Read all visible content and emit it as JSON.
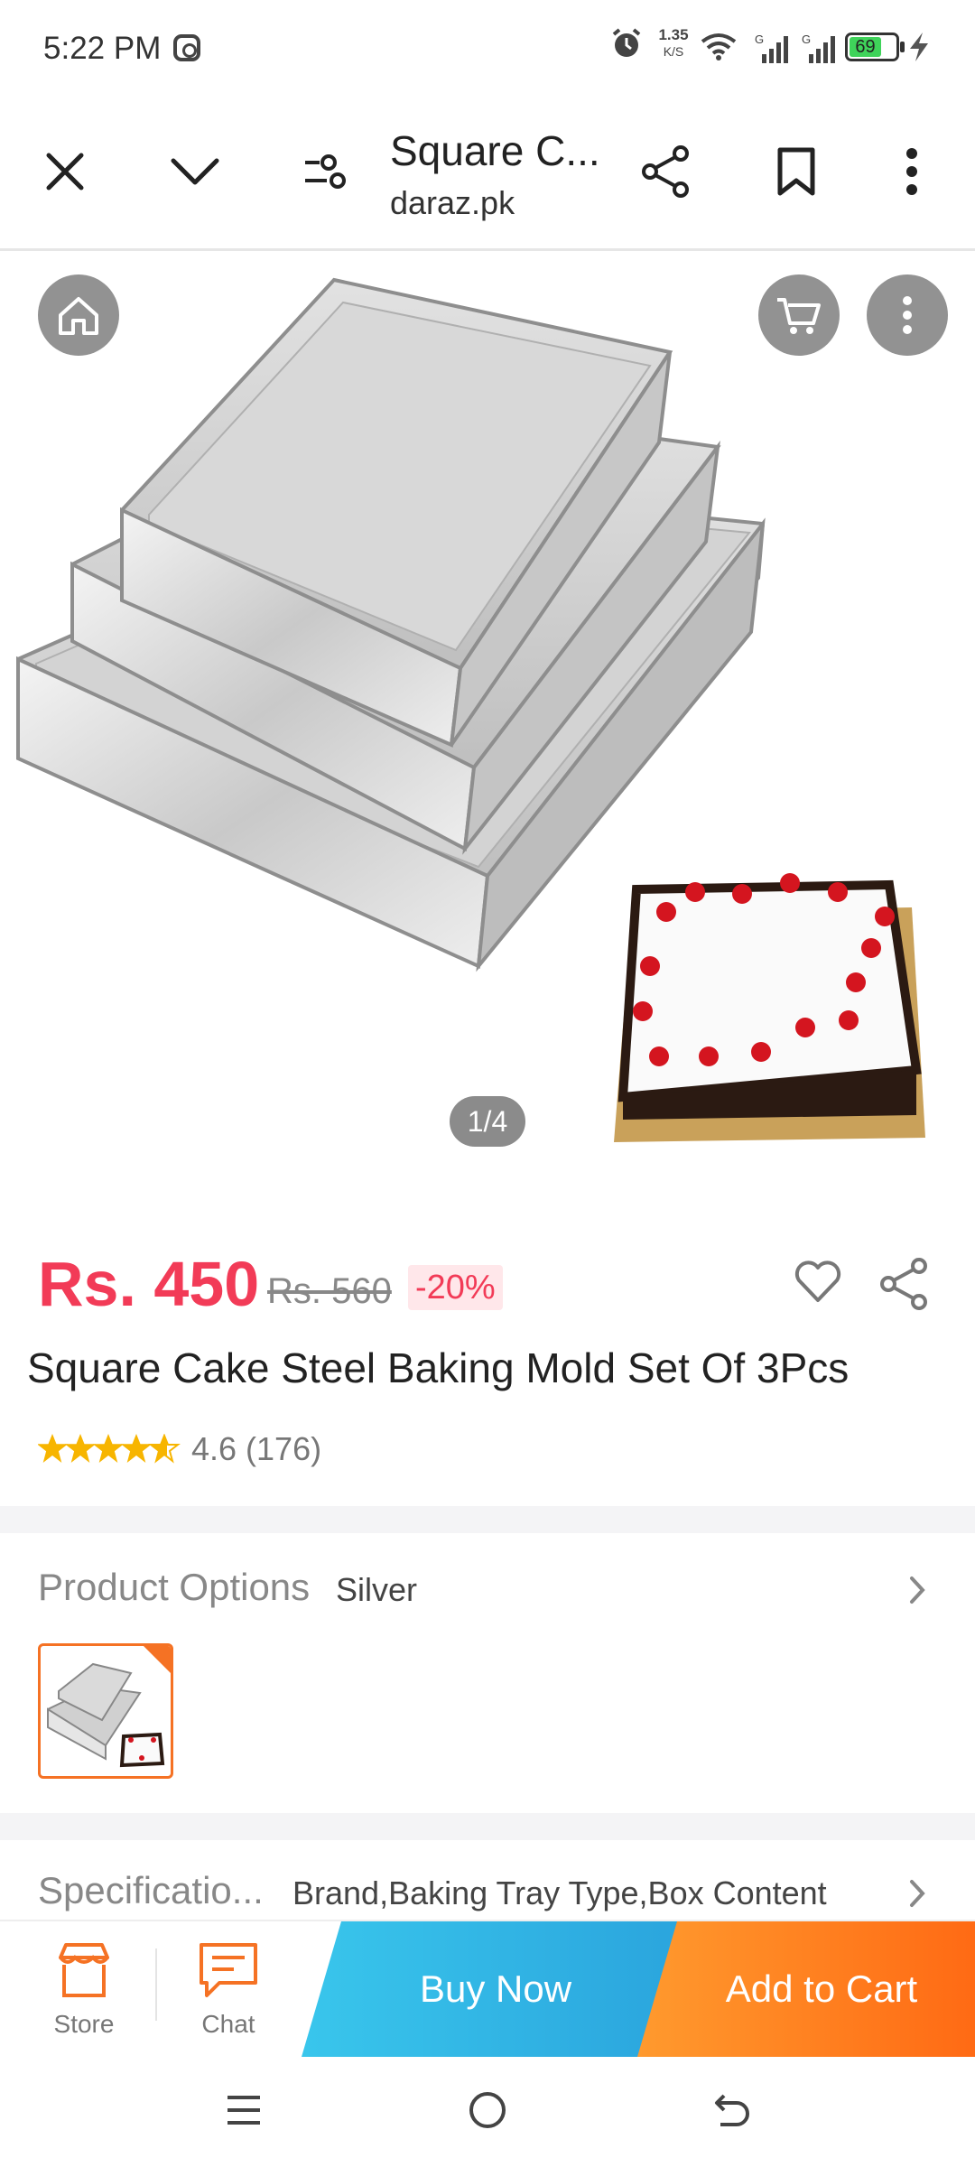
{
  "status_bar": {
    "time": "5:22 PM",
    "net_speed_top": "1.35",
    "net_speed_bottom": "K/S",
    "battery": "69",
    "icons": [
      "instagram-icon",
      "alarm-icon",
      "wifi-icon",
      "signal-icon",
      "battery-icon",
      "charging-icon"
    ]
  },
  "browser": {
    "title": "Square C...",
    "url": "daraz.pk"
  },
  "gallery": {
    "counter": "1/4"
  },
  "product": {
    "price": "Rs. 450",
    "original_price": "Rs. 560",
    "discount": "-20%",
    "title": "Square Cake Steel Baking Mold Set Of 3Pcs",
    "rating": 4.6,
    "rating_text": "4.6 (176)",
    "star_color": "#f7b500"
  },
  "options": {
    "label": "Product Options",
    "value": "Silver"
  },
  "specifications": {
    "label": "Specificatio...",
    "value": "Brand,Baking Tray Type,Box Content"
  },
  "action_bar": {
    "store_label": "Store",
    "chat_label": "Chat",
    "buy_now_label": "Buy Now",
    "add_to_cart_label": "Add to Cart"
  },
  "colors": {
    "price": "#f23b57",
    "accent_orange": "#f57224",
    "buy_now": "#2aa4dd"
  }
}
